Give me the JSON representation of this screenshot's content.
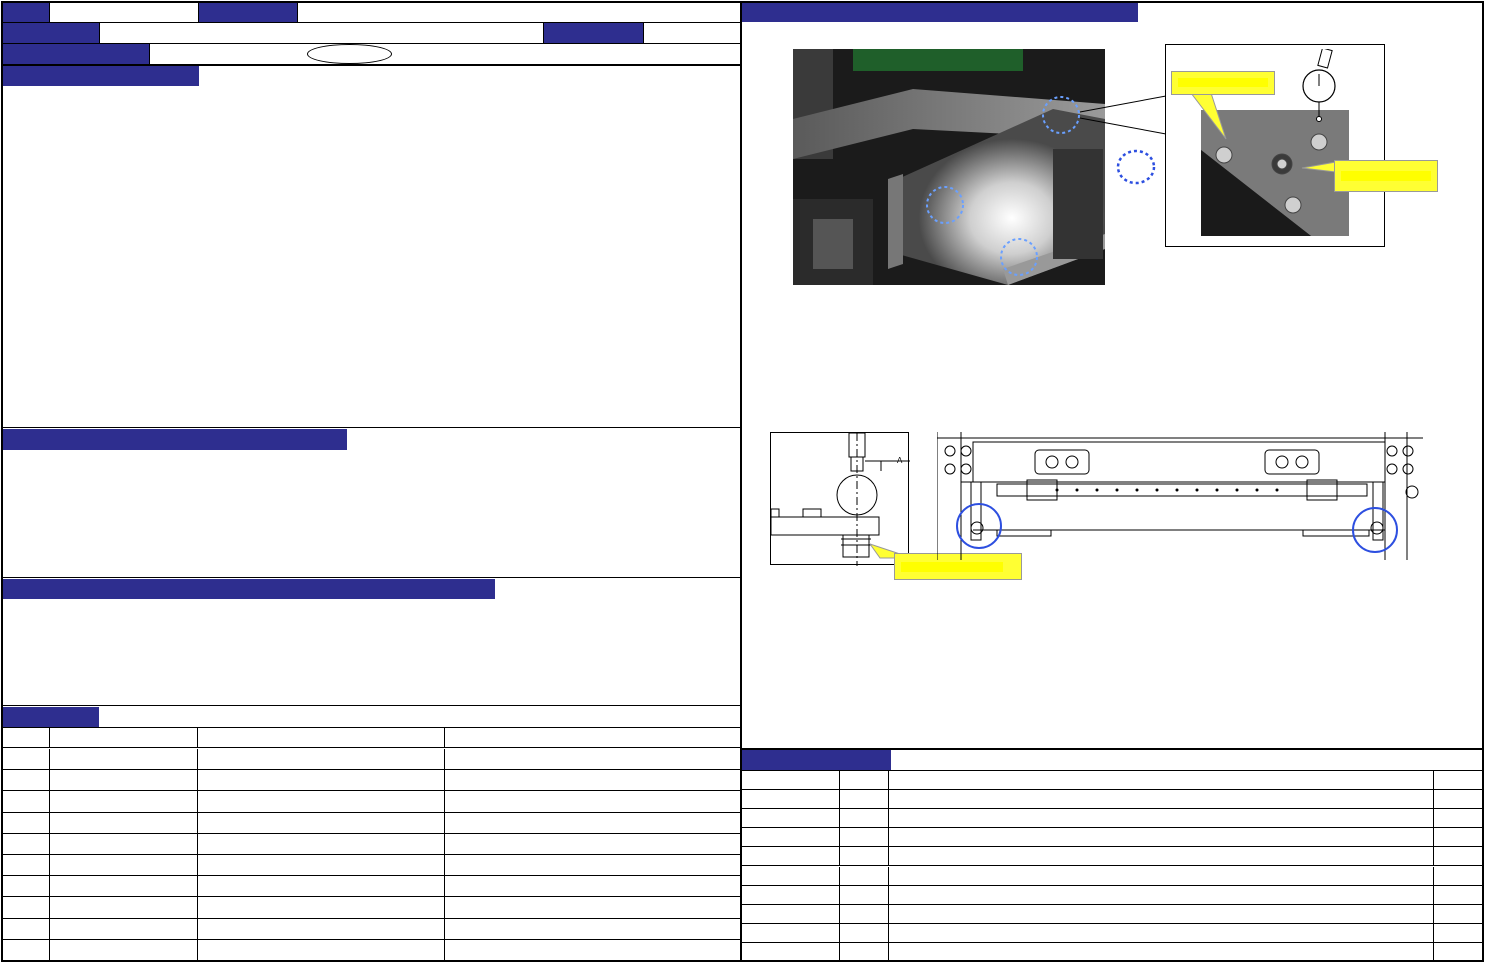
{
  "header": {
    "row1": [
      "",
      "",
      "",
      "",
      ""
    ],
    "row2": [
      "",
      "",
      "",
      ""
    ],
    "row3": [
      "",
      "",
      ""
    ],
    "ellipse_text": ""
  },
  "sections": {
    "section1_title": "",
    "section2_title": "",
    "section3_title": "",
    "parts_table_title": "",
    "history_table_title": ""
  },
  "parts_table": {
    "columns": [
      "",
      "",
      "",
      ""
    ],
    "rows": [
      [
        "",
        "",
        "",
        ""
      ],
      [
        "",
        "",
        "",
        ""
      ],
      [
        "",
        "",
        "",
        ""
      ],
      [
        "",
        "",
        "",
        ""
      ],
      [
        "",
        "",
        "",
        ""
      ],
      [
        "",
        "",
        "",
        ""
      ],
      [
        "",
        "",
        "",
        ""
      ],
      [
        "",
        "",
        "",
        ""
      ],
      [
        "",
        "",
        "",
        ""
      ],
      [
        "",
        "",
        "",
        ""
      ]
    ]
  },
  "history_table": {
    "rows": [
      [
        "",
        "",
        "",
        ""
      ],
      [
        "",
        "",
        "",
        ""
      ],
      [
        "",
        "",
        "",
        ""
      ],
      [
        "",
        "",
        "",
        ""
      ],
      [
        "",
        "",
        "",
        ""
      ],
      [
        "",
        "",
        "",
        ""
      ],
      [
        "",
        "",
        "",
        ""
      ],
      [
        "",
        "",
        "",
        ""
      ],
      [
        "",
        "",
        "",
        ""
      ],
      [
        "",
        "",
        "",
        ""
      ]
    ]
  },
  "figure": {
    "right_title": "",
    "callout_1": "",
    "callout_2": "",
    "callout_3": "",
    "dim_label": "A"
  },
  "colors": {
    "navy": "#2e2e8f",
    "callout_yellow": "#ffff33",
    "highlight_blue": "#2d4fe0"
  }
}
